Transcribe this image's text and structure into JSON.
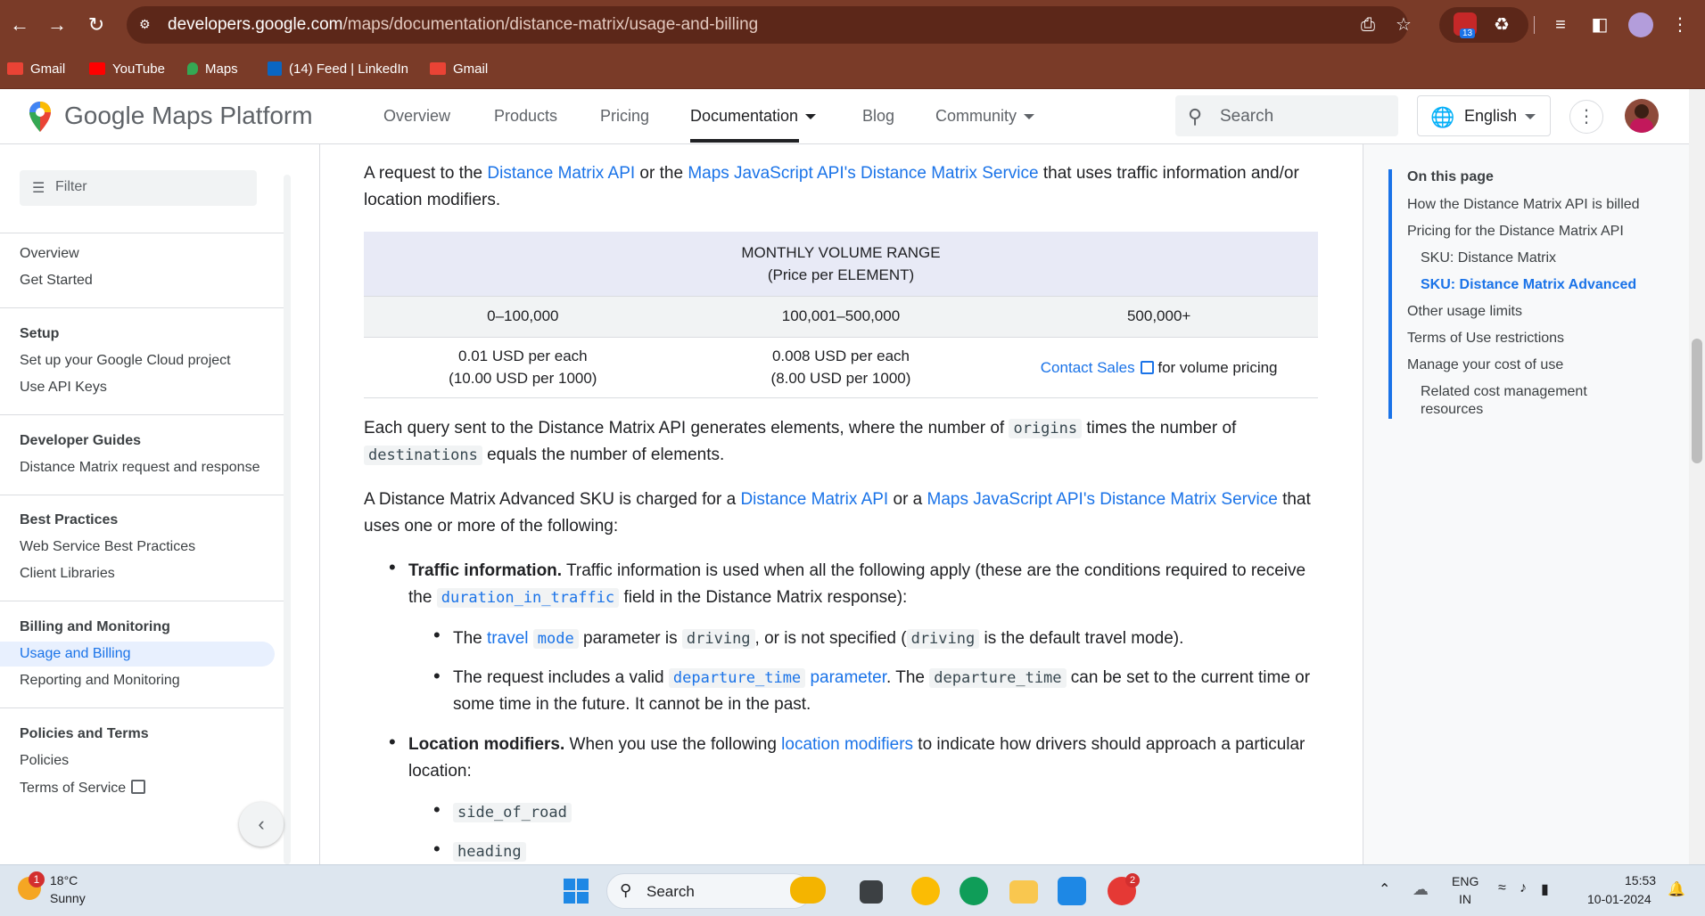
{
  "browser": {
    "url_host": "developers.google.com",
    "url_path": "/maps/documentation/distance-matrix/usage-and-billing",
    "extension_count": "13",
    "bookmarks": [
      {
        "label": "Gmail",
        "icon": "gmail-icon"
      },
      {
        "label": "YouTube",
        "icon": "youtube-icon"
      },
      {
        "label": "Maps",
        "icon": "maps-icon"
      },
      {
        "label": "(14) Feed | LinkedIn",
        "icon": "linkedin-icon"
      },
      {
        "label": "Gmail",
        "icon": "gmail-icon"
      }
    ]
  },
  "header": {
    "logo_text": "Google Maps Platform",
    "nav": [
      "Overview",
      "Products",
      "Pricing",
      "Documentation",
      "Blog",
      "Community"
    ],
    "active_nav": "Documentation",
    "search_placeholder": "Search",
    "language": "English"
  },
  "sidebar": {
    "filter_placeholder": "Filter",
    "top_items": [
      "Overview",
      "Get Started"
    ],
    "sections": [
      {
        "title": "Setup",
        "items": [
          "Set up your Google Cloud project",
          "Use API Keys"
        ]
      },
      {
        "title": "Developer Guides",
        "items": [
          "Distance Matrix request and response"
        ]
      },
      {
        "title": "Best Practices",
        "items": [
          "Web Service Best Practices",
          "Client Libraries"
        ]
      },
      {
        "title": "Billing and Monitoring",
        "items": [
          "Usage and Billing",
          "Reporting and Monitoring"
        ]
      },
      {
        "title": "Policies and Terms",
        "items": [
          "Policies",
          "Terms of Service"
        ]
      }
    ],
    "active_item": "Usage and Billing"
  },
  "content": {
    "intro": {
      "t1": "A request to the ",
      "l1": "Distance Matrix API",
      "t2": " or the ",
      "l2": "Maps JavaScript API's Distance Matrix Service",
      "t3": " that uses traffic information and/or location modifiers."
    },
    "table": {
      "header_line1": "MONTHLY VOLUME RANGE",
      "header_line2": "(Price per ELEMENT)",
      "ranges": [
        "0–100,000",
        "100,001–500,000",
        "500,000+"
      ],
      "price1_a": "0.01 USD per each",
      "price1_b": "(10.00 USD per 1000)",
      "price2_a": "0.008 USD per each",
      "price2_b": "(8.00 USD per 1000)",
      "contact_link": "Contact Sales",
      "contact_suffix": " for volume pricing"
    },
    "elements_para": {
      "t1": "Each query sent to the Distance Matrix API generates elements, where the number of ",
      "c1": "origins",
      "t2": " times the number of ",
      "c2": "destinations",
      "t3": " equals the number of elements."
    },
    "advanced_para": {
      "t1": "A Distance Matrix Advanced SKU is charged for a ",
      "l1": "Distance Matrix API",
      "t2": " or a ",
      "l2": "Maps JavaScript API's Distance Matrix Service",
      "t3": " that uses one or more of the following:"
    },
    "traffic": {
      "bold": "Traffic information.",
      "t1": " Traffic information is used when all the following apply (these are the conditions required to receive the ",
      "c1": "duration_in_traffic",
      "t2": " field in the Distance Matrix response):",
      "sub1": {
        "t1": "The ",
        "l1": "travel",
        "c1": "mode",
        "t2": " parameter is ",
        "c2": "driving",
        "t3": ", or is not specified (",
        "c3": "driving",
        "t4": " is the default travel mode)."
      },
      "sub2": {
        "t1": "The request includes a valid ",
        "c1": "departure_time",
        "l1": " parameter",
        "t2": ". The ",
        "c2": "departure_time",
        "t3": " can be set to the current time or some time in the future. It cannot be in the past."
      }
    },
    "location": {
      "bold": "Location modifiers.",
      "t1": " When you use the following ",
      "l1": "location modifiers",
      "t2": " to indicate how drivers should approach a particular location:",
      "items": [
        "side_of_road",
        "heading"
      ]
    }
  },
  "toc": {
    "title": "On this page",
    "items": [
      {
        "label": "How the Distance Matrix API is billed",
        "indent": 0
      },
      {
        "label": "Pricing for the Distance Matrix API",
        "indent": 0
      },
      {
        "label": "SKU: Distance Matrix",
        "indent": 1
      },
      {
        "label": "SKU: Distance Matrix Advanced",
        "indent": 1,
        "active": true
      },
      {
        "label": "Other usage limits",
        "indent": 0
      },
      {
        "label": "Terms of Use restrictions",
        "indent": 0
      },
      {
        "label": "Manage your cost of use",
        "indent": 0
      },
      {
        "label": "Related cost management",
        "indent": 1
      },
      {
        "label": "resources",
        "indent": 1
      }
    ]
  },
  "taskbar": {
    "weather_temp": "18°C",
    "weather_desc": "Sunny",
    "weather_badge": "1",
    "search_placeholder": "Search",
    "lang_line1": "ENG",
    "lang_line2": "IN",
    "time": "15:53",
    "date": "10-01-2024",
    "skype_badge": "2"
  },
  "colors": {
    "chrome": "#7a3b28",
    "link": "#1a73e8",
    "table_header": "#e8eaf6"
  }
}
